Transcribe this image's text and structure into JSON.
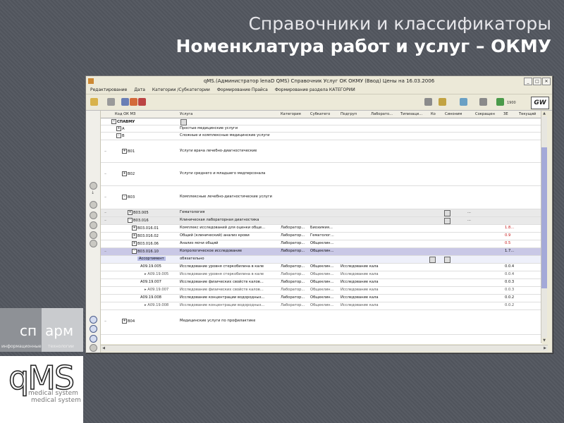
{
  "slide": {
    "title": "Справочники и классификаторы",
    "subtitle": "Номенклатура работ и услуг – ОКМУ"
  },
  "logos": {
    "cn": "сп",
    "apm": "арм",
    "cn_sub": "информационные",
    "apm_sub": "технологии",
    "qms": "qMS",
    "qms_sub1": "medical system",
    "qms_sub2": "medical system"
  },
  "window": {
    "title": "qMS.(Администратор lenaD QMS) Справочник Услуг ОК ОКМУ (Ввод) Цены на 16.03.2006",
    "menu": [
      "Редактирование",
      "Дата",
      "Категории /Субкатегории",
      "Формирование Прайса",
      "Формирование раздела КАТЕГОРИИ"
    ],
    "toolbar_year": "1900",
    "logo": "GW"
  },
  "grid": {
    "columns": [
      "Код ОК МЗ",
      "Услуга",
      "Категория",
      "Субкатего",
      "Подгруп",
      "Лаборато...",
      "Типизаци...",
      "Ко",
      "Синоним",
      "Сокращен",
      "ЗЕ",
      "Текущий"
    ],
    "rows": [
      {
        "code": "СПАВМУ",
        "name": "",
        "kind": "root"
      },
      {
        "code": "A",
        "name": "Простые медицинские услуги",
        "kind": "top"
      },
      {
        "code": "B",
        "name": "Сложные и комплексные медицинские услуги",
        "kind": "top"
      },
      {
        "code": "B01",
        "name": "Услуги врача лечебно-диагностические",
        "kind": "section"
      },
      {
        "code": "B02",
        "name": "Услуги среднего и младшего медперсонала",
        "kind": "section"
      },
      {
        "code": "B03",
        "name": "Комплексные лечебно-диагностические услуги",
        "kind": "section"
      },
      {
        "code": "B03.005",
        "name": "Гематология",
        "kind": "grey",
        "syn": "..."
      },
      {
        "code": "B03.016",
        "name": "Клиническая лабораторная диагностика",
        "kind": "grey",
        "syn": "..."
      },
      {
        "code": "B03.016.01",
        "name": "Комплекс исследований для оценки обще...",
        "cat": "Лаборатор...",
        "sub": "Биохимия...",
        "ze": "1.8...",
        "red": true
      },
      {
        "code": "B03.016.02",
        "name": "Общий (клинический) анализ крови",
        "cat": "Лаборатор...",
        "sub": "Гематолог...",
        "ze": "0.9",
        "red": true
      },
      {
        "code": "B03.016.06",
        "name": "Анализ мочи общий",
        "cat": "Лаборатор...",
        "sub": "Общеклин...",
        "ze": "0.5",
        "red": true
      },
      {
        "code": "B03.016.10",
        "name": "Копрологическое исследование",
        "cat": "Лаборатор...",
        "sub": "Общеклин...",
        "ze": "1.7...",
        "sel": true
      },
      {
        "code": "Ассортимент",
        "name": "обязательно",
        "kind": "assort"
      },
      {
        "code": "A09.19.005",
        "name": "Исследование уровня стеркобилина в кале",
        "cat": "Лаборатор...",
        "sub": "Общеклин...",
        "pod": "Исследование кала",
        "ze": "0.0.4"
      },
      {
        "code": "A09.19.005",
        "name": "Исследование уровня стеркобилина в кале",
        "cat": "Лаборатор...",
        "sub": "Общеклин...",
        "pod": "Исследование кала",
        "ze": "0.0.4",
        "subitem": true
      },
      {
        "code": "A09.19.007",
        "name": "Исследование физических свойств калов...",
        "cat": "Лаборатор...",
        "sub": "Общеклин...",
        "pod": "Исследование кала",
        "ze": "0.0.3"
      },
      {
        "code": "A09.19.007",
        "name": "Исследование физических свойств калов...",
        "cat": "Лаборатор...",
        "sub": "Общеклин...",
        "pod": "Исследование кала",
        "ze": "0.0.3",
        "subitem": true
      },
      {
        "code": "A09.19.008",
        "name": "Исследование концентрации водородных...",
        "cat": "Лаборатор...",
        "sub": "Общеклин...",
        "pod": "Исследование кала",
        "ze": "0.0.2"
      },
      {
        "code": "A09.19.008",
        "name": "Исследование концентрации водородных...",
        "cat": "Лаборатор...",
        "sub": "Общеклин...",
        "pod": "Исследование кала",
        "ze": "0.0.2",
        "subitem": true
      },
      {
        "code": "B04",
        "name": "Медицинские услуги по профилактике",
        "kind": "section"
      }
    ]
  }
}
